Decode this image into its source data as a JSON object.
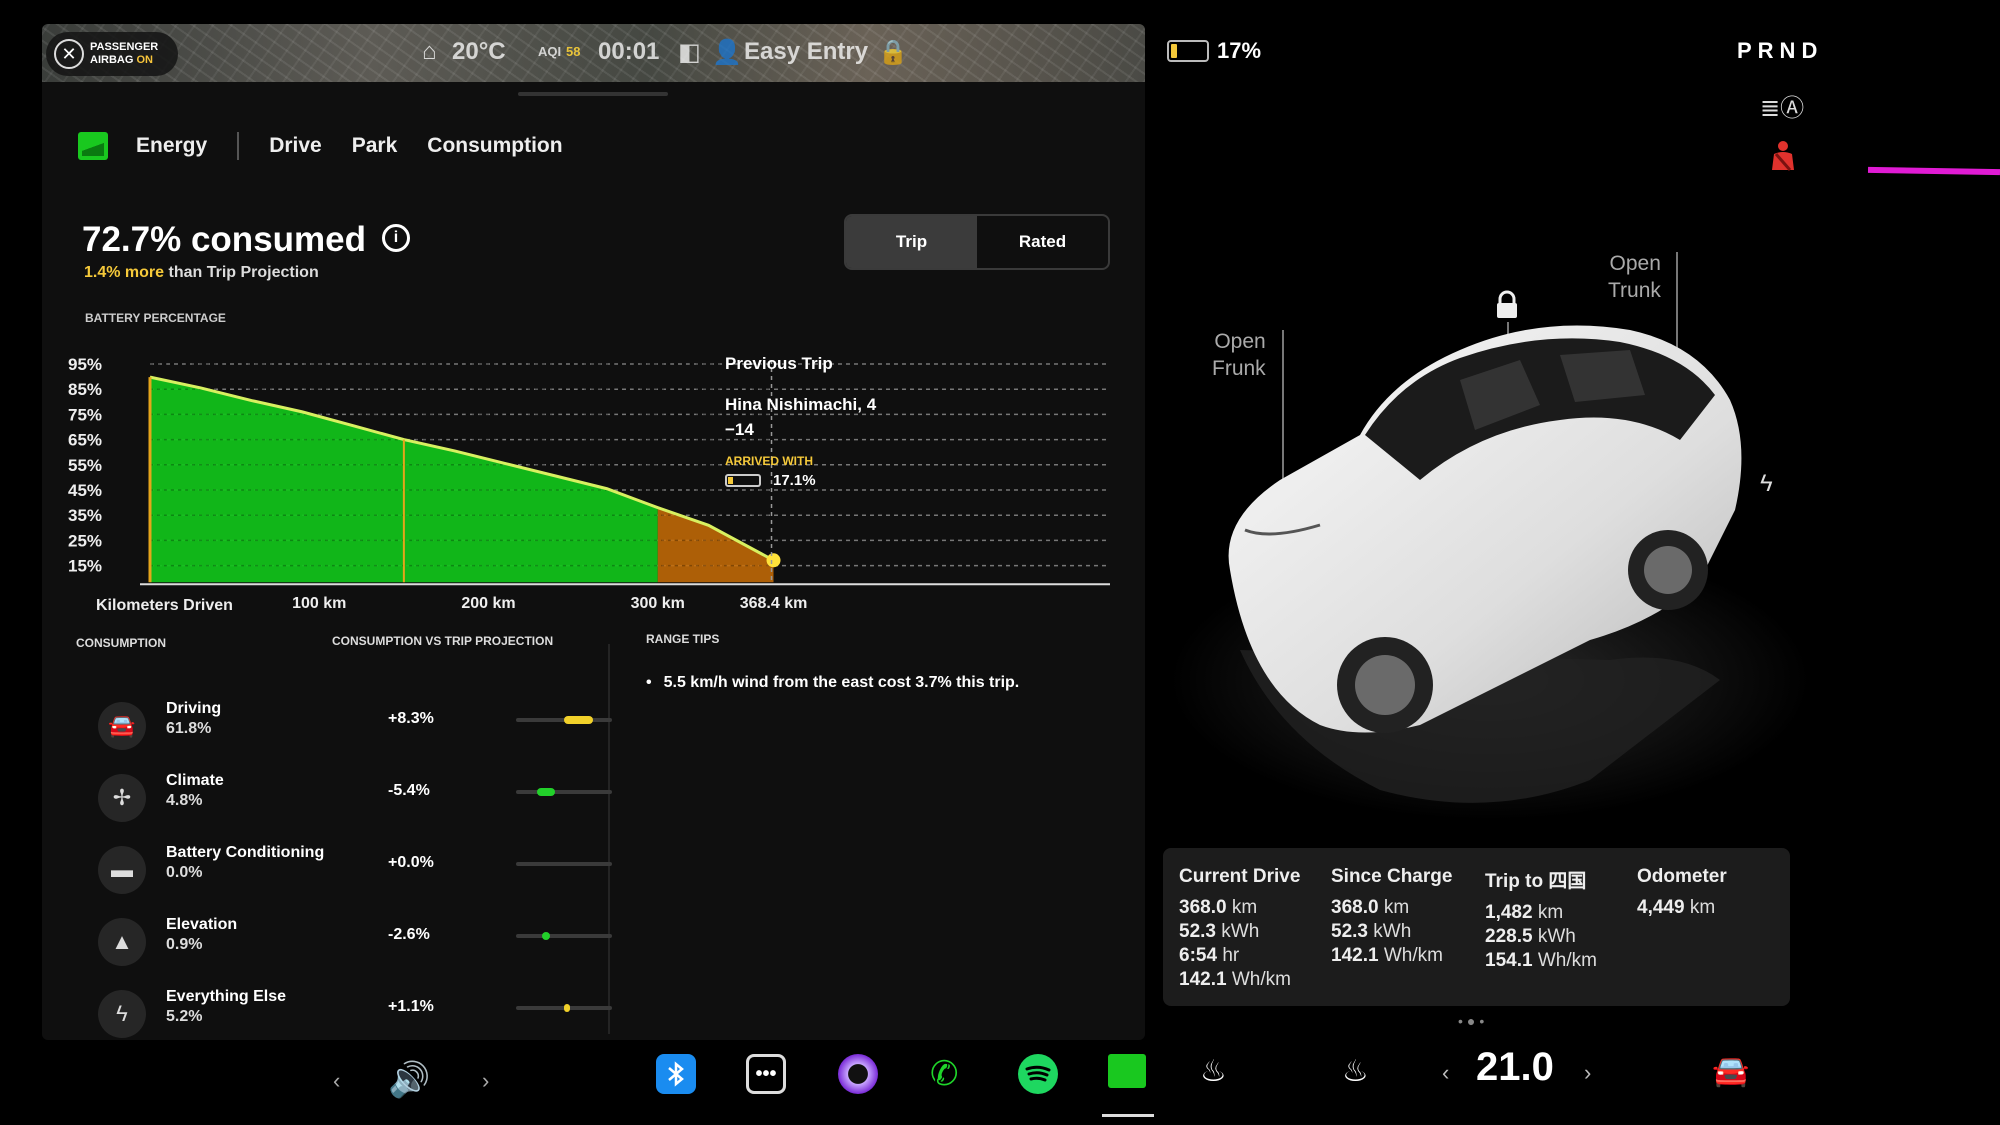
{
  "status_strip": {
    "airbag_line1": "PASSENGER",
    "airbag_line2_prefix": "AIRBAG",
    "airbag_line2_state": "ON",
    "temperature": "20°C",
    "aqi_label": "AQI",
    "aqi_value": "58",
    "time": "00:01",
    "profile": "Easy Entry"
  },
  "tabs": {
    "energy": "Energy",
    "drive": "Drive",
    "park": "Park",
    "consumption": "Consumption"
  },
  "summary": {
    "consumed": "72.7% consumed",
    "info_symbol": "i",
    "projection_highlight": "1.4% more",
    "projection_rest": " than Trip Projection"
  },
  "segmented": {
    "trip": "Trip",
    "rated": "Rated"
  },
  "previous_trip": {
    "heading": "Previous Trip",
    "destination": "Hina Nishimachi, 4 −14",
    "arrived_label": "ARRIVED WITH",
    "arrived_pct": "17.1%",
    "arrived_level": 0.171
  },
  "chart_data": {
    "type": "area",
    "ylabel": "BATTERY PERCENTAGE",
    "xlabel": "Kilometers Driven",
    "y_ticks": [
      "95%",
      "85%",
      "75%",
      "65%",
      "55%",
      "45%",
      "35%",
      "25%",
      "15%"
    ],
    "x_ticks": [
      "100 km",
      "200 km",
      "300 km",
      "368.4 km"
    ],
    "x_tick_values": [
      100,
      200,
      300,
      368.4
    ],
    "xlim": [
      0,
      400
    ],
    "ylim": [
      10,
      95
    ],
    "x": [
      0,
      30,
      60,
      90,
      120,
      150,
      180,
      210,
      240,
      270,
      300,
      330,
      368.4
    ],
    "y": [
      89.8,
      85.5,
      80.5,
      76.0,
      70.5,
      65.0,
      60.5,
      55.5,
      50.5,
      45.5,
      38.0,
      31.0,
      17.1
    ],
    "colors": {
      "main": "#11c41a",
      "projection_tail": "#c96d06",
      "marker": "#ffe23b"
    }
  },
  "consumption": {
    "title": "CONSUMPTION",
    "vs_title": "CONSUMPTION VS TRIP PROJECTION",
    "rows": [
      {
        "icon": "car-icon",
        "glyph": "🚘",
        "name": "Driving",
        "pct": "61.8%",
        "delta": "+8.3%",
        "bar_color": "#f2d12a",
        "bar_level": 0.3
      },
      {
        "icon": "fan-icon",
        "glyph": "✢",
        "name": "Climate",
        "pct": "4.8%",
        "delta": "-5.4%",
        "bar_color": "#22d02a",
        "bar_level": 0.18
      },
      {
        "icon": "battery-icon",
        "glyph": "▬",
        "name": "Battery Conditioning",
        "pct": "0.0%",
        "delta": "+0.0%",
        "bar_color": "#3a3a3a",
        "bar_level": 0.0
      },
      {
        "icon": "mountain-icon",
        "glyph": "▲",
        "name": "Elevation",
        "pct": "0.9%",
        "delta": "-2.6%",
        "bar_color": "#22d02a",
        "bar_level": 0.08
      },
      {
        "icon": "bolt-icon",
        "glyph": "ϟ",
        "name": "Everything Else",
        "pct": "5.2%",
        "delta": "+1.1%",
        "bar_color": "#f2d12a",
        "bar_level": 0.04
      }
    ]
  },
  "range_tips": {
    "title": "RANGE TIPS",
    "items": [
      "5.5 km/h wind from the east cost 3.7% this trip."
    ]
  },
  "vehicle": {
    "battery_pct": "17%",
    "battery_level": 0.17,
    "gear": "PRND",
    "frunk": "Open\nFrunk",
    "trunk": "Open\nTrunk"
  },
  "trip_card": {
    "current_drive": {
      "title": "Current Drive",
      "lines": [
        [
          "368.0",
          "km"
        ],
        [
          "52.3",
          "kWh"
        ],
        [
          "6:54",
          "hr"
        ],
        [
          "142.1",
          "Wh/km"
        ]
      ]
    },
    "since_charge": {
      "title": "Since Charge",
      "lines": [
        [
          "368.0",
          "km"
        ],
        [
          "52.3",
          "kWh"
        ],
        [
          "142.1",
          "Wh/km"
        ]
      ]
    },
    "trip_to": {
      "title": "Trip to 四国",
      "lines": [
        [
          "1,482",
          "km"
        ],
        [
          "228.5",
          "kWh"
        ],
        [
          "154.1",
          "Wh/km"
        ]
      ]
    },
    "odometer": {
      "title": "Odometer",
      "lines": [
        [
          "4,449",
          "km"
        ]
      ]
    }
  },
  "climate": {
    "temp": "21.0"
  },
  "dock": {
    "prev": "‹",
    "next": "›",
    "dots": "•••"
  }
}
